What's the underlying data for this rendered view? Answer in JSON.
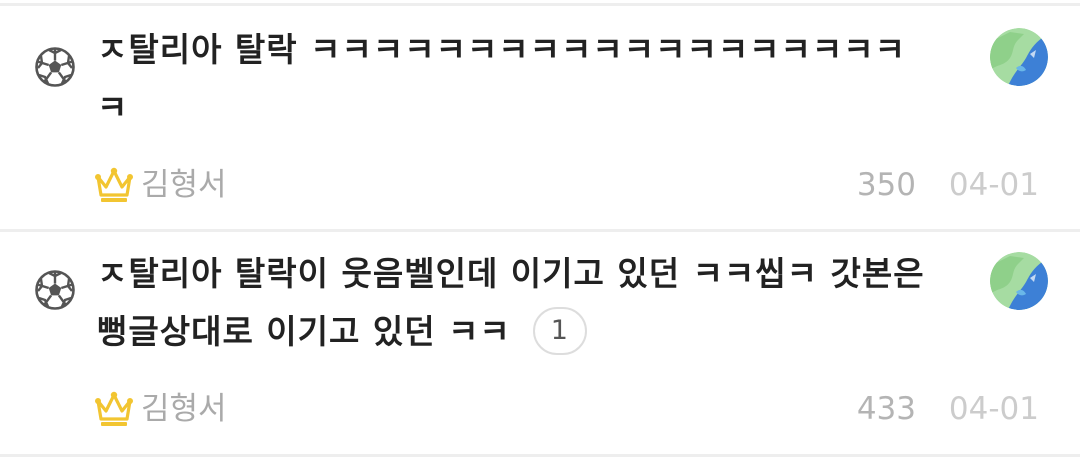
{
  "posts": [
    {
      "title": "ㅈ탈리아 탈락 ㅋㅋㅋㅋㅋㅋㅋㅋㅋㅋㅋㅋㅋㅋㅋㅋㅋㅋㅋㅋ",
      "comment_count": "",
      "author": "김형서",
      "views": "350",
      "date": "04-01",
      "category_icon": "soccer-ball-icon",
      "author_badge_icon": "crown-icon"
    },
    {
      "title": "ㅈ탈리아 탈락이 웃음벨인데 이기고 있던 ㅋㅋ씹ㅋ 갓본은 뻥글상대로 이기고 있던 ㅋㅋ",
      "comment_count": "1",
      "author": "김형서",
      "views": "433",
      "date": "04-01",
      "category_icon": "soccer-ball-icon",
      "author_badge_icon": "crown-icon"
    }
  ],
  "colors": {
    "title": "#222222",
    "author": "#aaaaaa",
    "views": "#b4b4b4",
    "date": "#cccccc",
    "crown": "#f2c531",
    "divider": "#eeeeee"
  }
}
